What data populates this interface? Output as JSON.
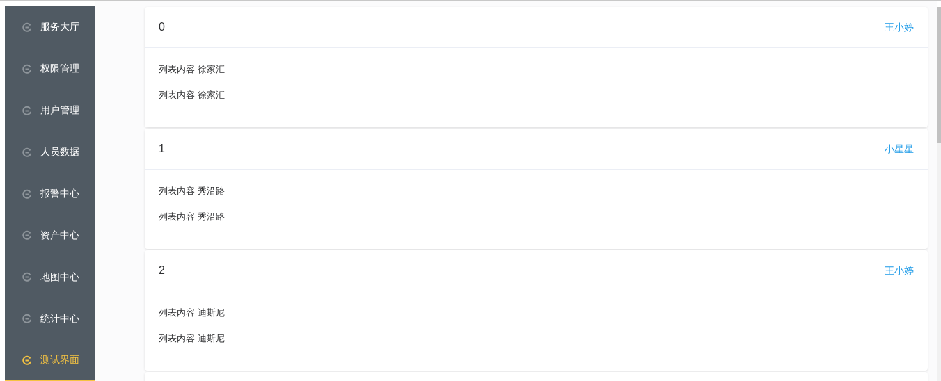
{
  "sidebar": {
    "items": [
      {
        "label": "服务大厅",
        "selected": false
      },
      {
        "label": "权限管理",
        "selected": false
      },
      {
        "label": "用户管理",
        "selected": false
      },
      {
        "label": "人员数据",
        "selected": false
      },
      {
        "label": "报警中心",
        "selected": false
      },
      {
        "label": "资产中心",
        "selected": false
      },
      {
        "label": "地图中心",
        "selected": false
      },
      {
        "label": "统计中心",
        "selected": false
      },
      {
        "label": "测试界面",
        "selected": true
      }
    ]
  },
  "cards": [
    {
      "title": "0",
      "link": "王小婷",
      "lines": [
        "列表内容 徐家汇",
        "列表内容 徐家汇"
      ]
    },
    {
      "title": "1",
      "link": "小星星",
      "lines": [
        "列表内容 秀沿路",
        "列表内容 秀沿路"
      ]
    },
    {
      "title": "2",
      "link": "王小婷",
      "lines": [
        "列表内容 迪斯尼",
        "列表内容 迪斯尼"
      ]
    }
  ]
}
